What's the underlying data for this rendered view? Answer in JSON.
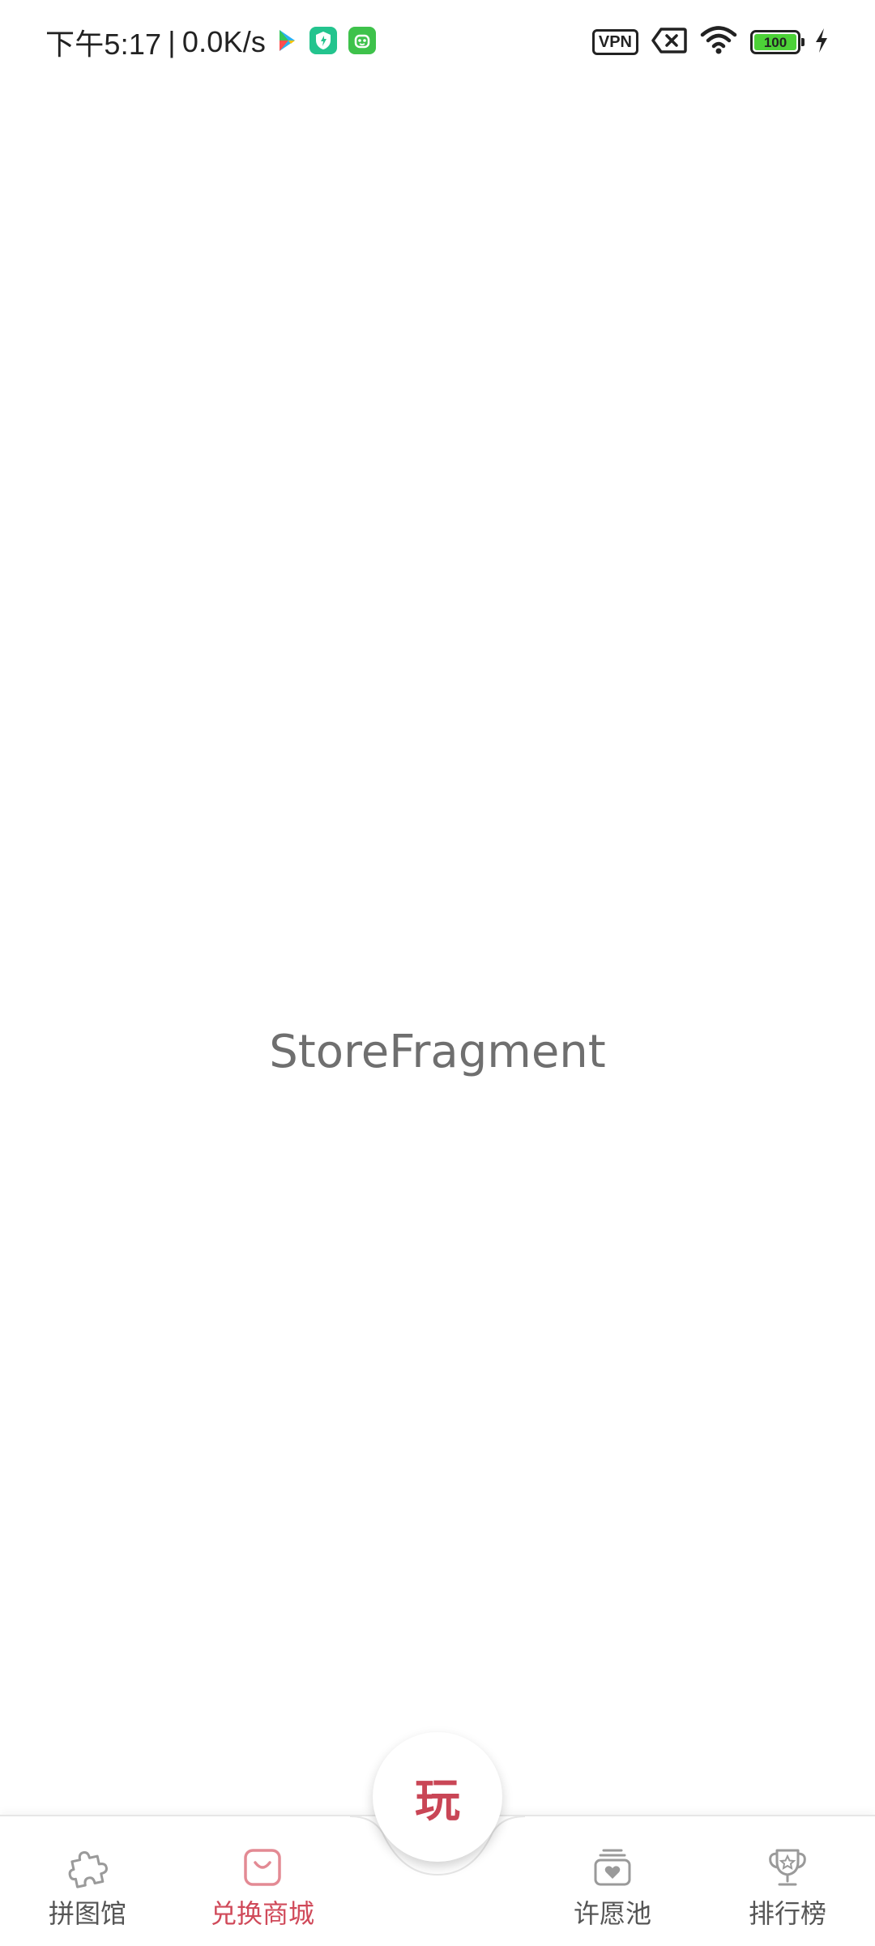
{
  "status_bar": {
    "time": "下午5:17",
    "separator": "|",
    "net_speed": "0.0K/s",
    "vpn_label": "VPN",
    "battery_level": "100",
    "colors": {
      "battery_fill": "#4cd137",
      "notif_green": "#23c48e",
      "notif_android": "#3ec24b"
    }
  },
  "main": {
    "fragment_label": "StoreFragment"
  },
  "bottom_nav": {
    "items": [
      {
        "label": "拼图馆",
        "icon": "puzzle-icon",
        "active": false
      },
      {
        "label": "兑换商城",
        "icon": "shopping-bag-icon",
        "active": true
      },
      {
        "label": "许愿池",
        "icon": "wish-pool-icon",
        "active": false
      },
      {
        "label": "排行榜",
        "icon": "trophy-icon",
        "active": false
      }
    ],
    "center_button": {
      "label": "玩"
    },
    "colors": {
      "active": "#d04a5a",
      "inactive": "#555555",
      "play": "#c94656"
    }
  }
}
